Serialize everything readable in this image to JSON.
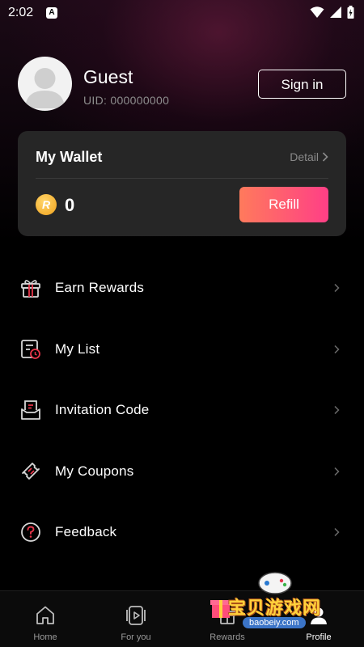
{
  "status_bar": {
    "time": "2:02",
    "app_icon": "A"
  },
  "profile": {
    "name": "Guest",
    "uid": "UID: 000000000",
    "sign_in_label": "Sign in"
  },
  "wallet": {
    "title": "My Wallet",
    "detail_label": "Detail",
    "coin_symbol": "R",
    "balance": "0",
    "refill_label": "Refill"
  },
  "menu": {
    "items": [
      {
        "label": "Earn Rewards",
        "icon": "gift-icon"
      },
      {
        "label": "My List",
        "icon": "list-clock-icon"
      },
      {
        "label": "Invitation Code",
        "icon": "invitation-icon"
      },
      {
        "label": "My Coupons",
        "icon": "ticket-icon"
      },
      {
        "label": "Feedback",
        "icon": "question-icon"
      }
    ]
  },
  "bottom_nav": {
    "items": [
      {
        "label": "Home",
        "icon": "home-icon"
      },
      {
        "label": "For you",
        "icon": "video-icon"
      },
      {
        "label": "Rewards",
        "icon": "gift-icon"
      },
      {
        "label": "Profile",
        "icon": "profile-icon"
      }
    ],
    "active": "Profile"
  },
  "watermark": {
    "text": "宝贝游戏网",
    "url": "baobeiy.com"
  },
  "colors": {
    "accent_start": "#ff7a5c",
    "accent_end": "#ff3f86",
    "icon_red": "#e8354a",
    "card_bg": "#262626",
    "coin": "#f0a21c"
  }
}
